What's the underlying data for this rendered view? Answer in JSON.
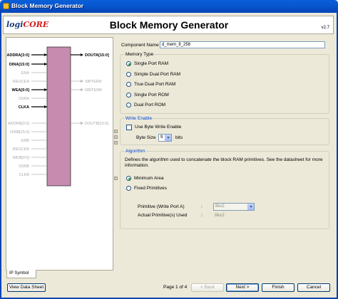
{
  "window": {
    "title": "Block Memory Generator"
  },
  "header": {
    "logo_main": "logi",
    "logo_core": "CORE",
    "title": "Block Memory Generator",
    "version": "v2.7"
  },
  "symbol": {
    "tab_label": "IP Symbol",
    "left_pins": [
      {
        "label": "ADDRA[3:0]",
        "active": true
      },
      {
        "label": "DINA[15:0]",
        "active": true
      },
      {
        "label": "ENA",
        "active": false
      },
      {
        "label": "REGCEA",
        "active": false
      },
      {
        "label": "WEA[0:0]",
        "active": true
      },
      {
        "label": "SSRA",
        "active": false
      },
      {
        "label": "CLKA",
        "active": true
      },
      {
        "label": "ADDRB[3:0]",
        "active": false
      },
      {
        "label": "DINB[15:0]",
        "active": false
      },
      {
        "label": "ENB",
        "active": false
      },
      {
        "label": "REGCEB",
        "active": false
      },
      {
        "label": "WEB[0:0]",
        "active": false
      },
      {
        "label": "SSRB",
        "active": false
      },
      {
        "label": "CLKB",
        "active": false
      }
    ],
    "right_pins": [
      {
        "label": "DOUTA[15:0]",
        "active": true
      },
      {
        "label": "SBITERR",
        "active": false
      },
      {
        "label": "DBITERR",
        "active": false
      },
      {
        "label": "DOUTB[15:0]",
        "active": false
      }
    ]
  },
  "form": {
    "component_name_label": "Component Name",
    "component_name_value": "d_mem_8_256",
    "memory_type": {
      "title": "Memory Type",
      "options": [
        "Single Port RAM",
        "Simple Dual Port RAM",
        "True Dual Port RAM",
        "Single Port ROM",
        "Dual Port ROM"
      ],
      "selected": 0
    },
    "write_enable": {
      "title": "Write Enable",
      "byte_write_label": "Use Byte Write Enable",
      "byte_size_label": "Byte Size",
      "byte_size_value": "9",
      "bits_label": "bits"
    },
    "algorithm": {
      "title": "Algorithm",
      "description": "Defines the algorithm used to concatenate the block RAM primitives.  See the datasheet for more information.",
      "options": [
        "Minimum Area",
        "Fixed Primitives"
      ],
      "selected": 0,
      "primitive_label": "Primitive (Write Port A)",
      "primitive_value": "8kx2",
      "actual_label": "Actual Primitive(s) Used",
      "actual_value": "8kx2"
    }
  },
  "footer": {
    "datasheet_label": "View Data Sheet",
    "page_text": "Page 1 of 4",
    "back_label": "< Back",
    "next_label": "Next >",
    "finish_label": "Finish",
    "cancel_label": "Cancel"
  }
}
